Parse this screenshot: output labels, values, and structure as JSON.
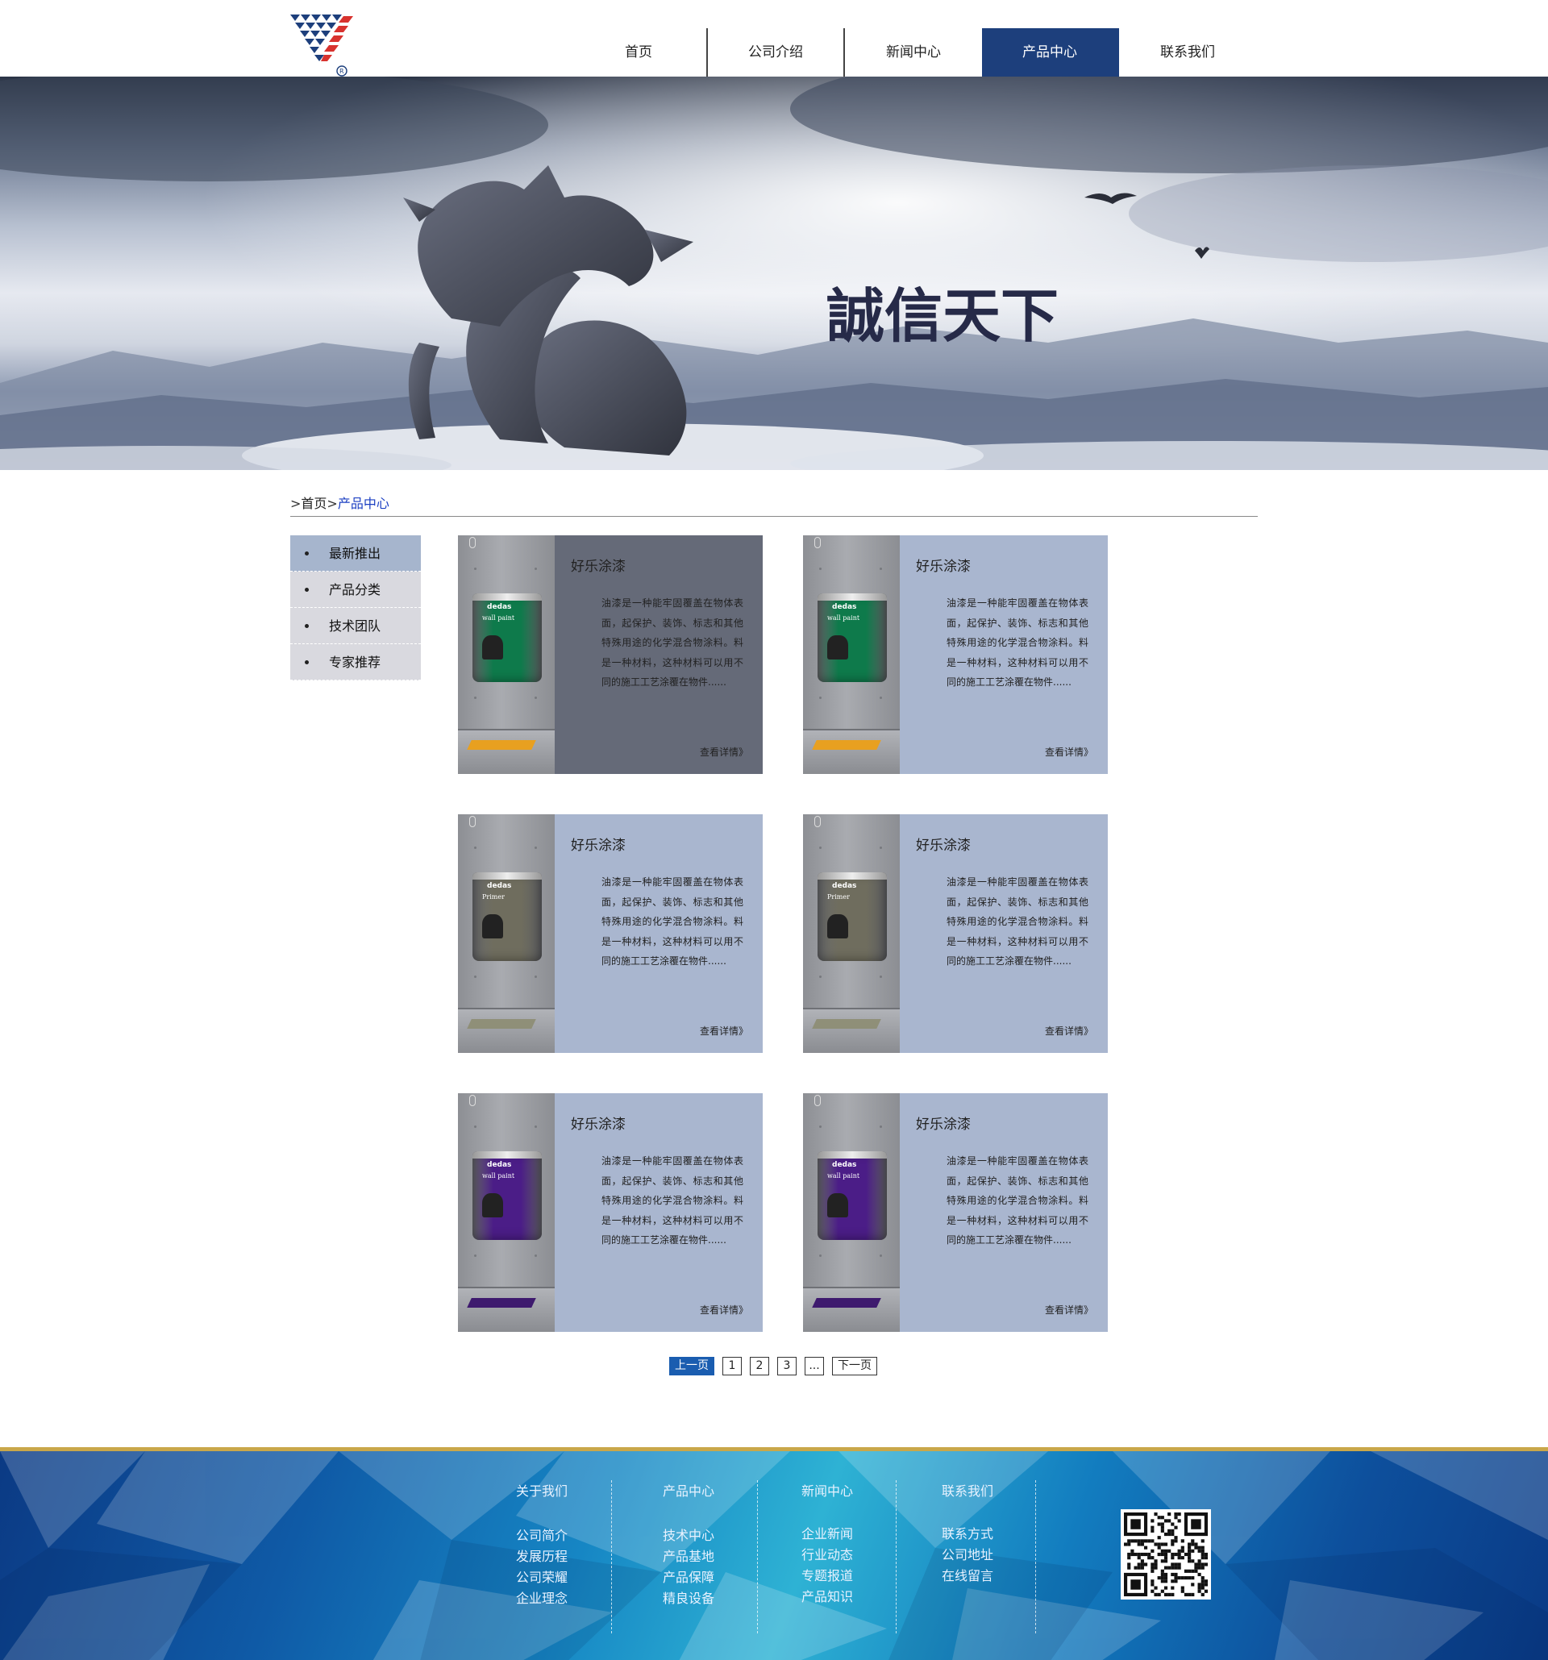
{
  "nav": {
    "items": [
      {
        "label": "首页",
        "active": false
      },
      {
        "label": "公司介绍",
        "active": false
      },
      {
        "label": "新闻中心",
        "active": false
      },
      {
        "label": "产品中心",
        "active": true
      },
      {
        "label": "联系我们",
        "active": false
      }
    ]
  },
  "banner": {
    "slogan": "誠信天下"
  },
  "breadcrumb": {
    "sep": ">",
    "home": "首页",
    "current": "产品中心"
  },
  "sidebar": {
    "items": [
      {
        "label": "最新推出",
        "active": true
      },
      {
        "label": "产品分类",
        "active": false
      },
      {
        "label": "技术团队",
        "active": false
      },
      {
        "label": "专家推荐",
        "active": false
      }
    ]
  },
  "products": [
    {
      "title": "好乐涂漆",
      "desc": "油漆是一种能牢固覆盖在物体表面，起保护、装饰、标志和其他特殊用途的化学混合物涂料。料是一种材料，这种材料可以用不同的施工工艺涂覆在物件......",
      "more": "查看详情》",
      "can_brand": "dedas",
      "can_label": "wall paint",
      "can_color": "#0e7a4b",
      "mat_color": "#e8a020",
      "panel_color": "#656a78"
    },
    {
      "title": "好乐涂漆",
      "desc": "油漆是一种能牢固覆盖在物体表面，起保护、装饰、标志和其他特殊用途的化学混合物涂料。料是一种材料，这种材料可以用不同的施工工艺涂覆在物件......",
      "more": "查看详情》",
      "can_brand": "dedas",
      "can_label": "wall paint",
      "can_color": "#0e7a4b",
      "mat_color": "#e8a020",
      "panel_color": "#a9b6cf"
    },
    {
      "title": "好乐涂漆",
      "desc": "油漆是一种能牢固覆盖在物体表面，起保护、装饰、标志和其他特殊用途的化学混合物涂料。料是一种材料，这种材料可以用不同的施工工艺涂覆在物件......",
      "more": "查看详情》",
      "can_brand": "dedas",
      "can_label": "Primer",
      "can_color": "#6f6d5e",
      "mat_color": "#8f8f78",
      "panel_color": "#a9b6cf"
    },
    {
      "title": "好乐涂漆",
      "desc": "油漆是一种能牢固覆盖在物体表面，起保护、装饰、标志和其他特殊用途的化学混合物涂料。料是一种材料，这种材料可以用不同的施工工艺涂覆在物件......",
      "more": "查看详情》",
      "can_brand": "dedas",
      "can_label": "Primer",
      "can_color": "#6f6d5e",
      "mat_color": "#8f8f78",
      "panel_color": "#a9b6cf"
    },
    {
      "title": "好乐涂漆",
      "desc": "油漆是一种能牢固覆盖在物体表面，起保护、装饰、标志和其他特殊用途的化学混合物涂料。料是一种材料，这种材料可以用不同的施工工艺涂覆在物件......",
      "more": "查看详情》",
      "can_brand": "dedas",
      "can_label": "wall paint",
      "can_color": "#4b1d87",
      "mat_color": "#3e1a6e",
      "panel_color": "#a9b6cf"
    },
    {
      "title": "好乐涂漆",
      "desc": "油漆是一种能牢固覆盖在物体表面，起保护、装饰、标志和其他特殊用途的化学混合物涂料。料是一种材料，这种材料可以用不同的施工工艺涂覆在物件......",
      "more": "查看详情》",
      "can_brand": "dedas",
      "can_label": "wall paint",
      "can_color": "#4b1d87",
      "mat_color": "#3e1a6e",
      "panel_color": "#a9b6cf"
    }
  ],
  "pagination": {
    "prev": "上一页",
    "pages": [
      "1",
      "2",
      "3",
      "..."
    ],
    "next": "下一页"
  },
  "footer": {
    "columns": [
      {
        "heading": "关于我们",
        "links": [
          "公司简介",
          "发展历程",
          "公司荣耀",
          "企业理念"
        ]
      },
      {
        "heading": "产品中心",
        "links": [
          "技术中心",
          "产品基地",
          "产品保障",
          "精良设备"
        ]
      },
      {
        "heading": "新闻中心",
        "links": [
          "企业新闻",
          "行业动态",
          "专题报道",
          "产品知识"
        ]
      },
      {
        "heading": "联系我们",
        "links": [
          "联系方式",
          "公司地址",
          "在线留言"
        ]
      }
    ]
  },
  "colors": {
    "nav_active": "#1d3f7c",
    "breadcrumb_current": "#1b3fc2",
    "sidebar_active": "#a6b5cd",
    "sidebar_item": "#d9d9df",
    "pager_active": "#1a5db0",
    "footer_gold": "#c9a74a"
  }
}
